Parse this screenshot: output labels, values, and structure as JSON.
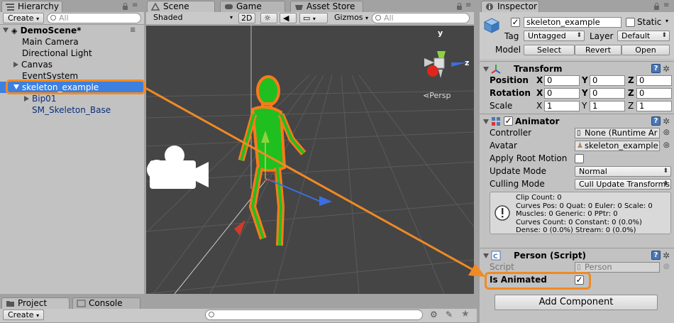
{
  "hierarchy": {
    "tab": "Hierarchy",
    "create_label": "Create",
    "search_placeholder": "All",
    "scene": "DemoScene*",
    "items": [
      "Main Camera",
      "Directional Light",
      "Canvas",
      "EventSystem",
      "skeleton_example",
      "Bip01",
      "SM_Skeleton_Base"
    ]
  },
  "scene": {
    "tabs": [
      "Scene",
      "Game",
      "Asset Store"
    ],
    "shading": "Shaded",
    "mode_2d": "2D",
    "gizmos": "Gizmos",
    "search_placeholder": "All",
    "axis_y": "y",
    "axis_z": "z",
    "persp": "Persp"
  },
  "inspector": {
    "tab": "Inspector",
    "object_name": "skeleton_example",
    "static_label": "Static",
    "tag_label": "Tag",
    "tag_value": "Untagged",
    "layer_label": "Layer",
    "layer_value": "Default",
    "model_label": "Model",
    "select": "Select",
    "revert": "Revert",
    "open": "Open",
    "transform": {
      "title": "Transform",
      "position_label": "Position",
      "rotation_label": "Rotation",
      "scale_label": "Scale",
      "x": "X",
      "y": "Y",
      "z": "Z",
      "position": [
        "0",
        "0",
        "0"
      ],
      "rotation": [
        "0",
        "0",
        "0"
      ],
      "scale": [
        "1",
        "1",
        "1"
      ]
    },
    "animator": {
      "title": "Animator",
      "controller_label": "Controller",
      "controller_value": "None (Runtime Ar",
      "avatar_label": "Avatar",
      "avatar_value": "skeleton_example",
      "root_motion_label": "Apply Root Motion",
      "update_mode_label": "Update Mode",
      "update_mode_value": "Normal",
      "culling_mode_label": "Culling Mode",
      "culling_mode_value": "Cull Update Transforms",
      "info": [
        "Clip Count: 0",
        "Curves Pos: 0 Quat: 0 Euler: 0 Scale: 0",
        "Muscles: 0 Generic: 0 PPtr: 0",
        "Curves Count: 0 Constant: 0 (0.0%)",
        "Dense: 0 (0.0%) Stream: 0 (0.0%)"
      ]
    },
    "script": {
      "title": "Person (Script)",
      "script_label": "Script",
      "script_value": "Person",
      "is_animated_label": "Is Animated"
    },
    "add_component": "Add Component"
  },
  "bottom": {
    "tabs": [
      "Project",
      "Console"
    ],
    "create_label": "Create"
  },
  "colors": {
    "annotation": "#f08a24",
    "selection": "#3d80df",
    "skeleton": "#1fbf1f",
    "outline": "#ff7a1a"
  }
}
